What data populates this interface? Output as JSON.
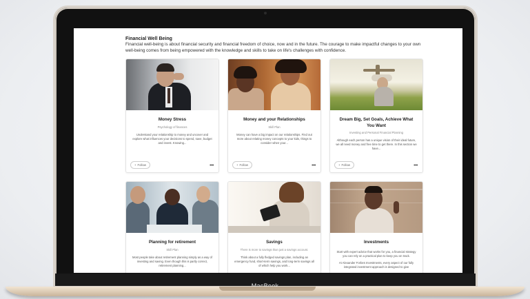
{
  "device": {
    "brand_label": "MacBook"
  },
  "section": {
    "title": "Financial Well Being",
    "description": "Financial well-being is about financial security and financial freedom of choice, now and in the future. The courage to make impactful changes to your own well-being comes from being empowered with the knowledge and skills to take on life's challenges with confidence."
  },
  "follow_label": "Follow",
  "more_icon": "more-horizontal-icon",
  "cards": [
    {
      "title": "Money Stress",
      "subtitle": "Psychology of finances",
      "description": "Understand your relationship to money and uncover and explore what influences your decisions to spend, save, budget and invest. Knowing..."
    },
    {
      "title": "Money and your Relationships",
      "subtitle": "Skill Plan",
      "description": "Money can have a big impact on our relationships. Find out more about relating money concepts to your kids, things to consider when your..."
    },
    {
      "title": "Dream Big, Set Goals, Achieve What You Want",
      "subtitle": "Investing and Personal Financial Planning",
      "description": "Although each person has a unique vision of their ideal future, we all need money and free time to get there. In this section we have..."
    },
    {
      "title": "Planning for retirement",
      "subtitle": "Skill Plan",
      "description": "Most people take about retirement planning simply as a way of investing and saving. Even though this is partly correct, retirement planning..."
    },
    {
      "title": "Savings",
      "subtitle": "There is more to savings than just a savings account.",
      "description": "Think about a fully fledged savings plan, including an emergency fund, short-term savings, and long-term savings all of which help you work..."
    },
    {
      "title": "Investments",
      "subtitle": "",
      "description": "Start with expert advice that works for you, a financial strategy you can rely on a practical plan to keep you on track.",
      "description2": "At Alexander Forbes Investments, every aspect of our fully integrated investment approach is designed to give"
    }
  ]
}
